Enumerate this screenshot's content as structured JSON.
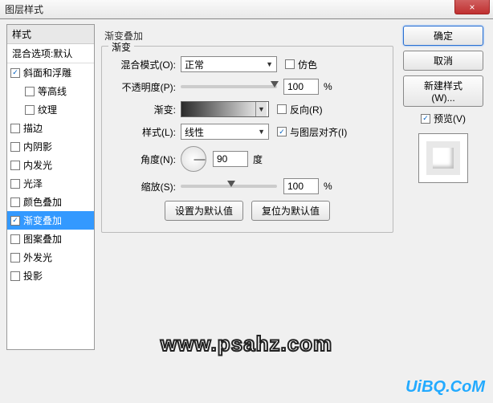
{
  "window": {
    "title": "图层样式",
    "close": "×"
  },
  "sidebar": {
    "header": "样式",
    "blend": "混合选项:默认",
    "items": [
      {
        "label": "斜面和浮雕",
        "checked": true,
        "indent": false
      },
      {
        "label": "等高线",
        "checked": false,
        "indent": true
      },
      {
        "label": "纹理",
        "checked": false,
        "indent": true
      },
      {
        "label": "描边",
        "checked": false,
        "indent": false
      },
      {
        "label": "内阴影",
        "checked": false,
        "indent": false
      },
      {
        "label": "内发光",
        "checked": false,
        "indent": false
      },
      {
        "label": "光泽",
        "checked": false,
        "indent": false
      },
      {
        "label": "颜色叠加",
        "checked": false,
        "indent": false
      },
      {
        "label": "渐变叠加",
        "checked": true,
        "indent": false,
        "selected": true
      },
      {
        "label": "图案叠加",
        "checked": false,
        "indent": false
      },
      {
        "label": "外发光",
        "checked": false,
        "indent": false
      },
      {
        "label": "投影",
        "checked": false,
        "indent": false
      }
    ]
  },
  "panel": {
    "title": "渐变叠加",
    "legend": "渐变",
    "blendMode": {
      "label": "混合模式(O):",
      "value": "正常",
      "dither": "仿色"
    },
    "opacity": {
      "label": "不透明度(P):",
      "value": "100",
      "unit": "%"
    },
    "gradient": {
      "label": "渐变:",
      "reverse": "反向(R)"
    },
    "style": {
      "label": "样式(L):",
      "value": "线性",
      "align": "与图层对齐(I)"
    },
    "angle": {
      "label": "角度(N):",
      "value": "90",
      "unit": "度"
    },
    "scale": {
      "label": "缩放(S):",
      "value": "100",
      "unit": "%"
    },
    "defaults": {
      "set": "设置为默认值",
      "reset": "复位为默认值"
    }
  },
  "right": {
    "ok": "确定",
    "cancel": "取消",
    "newStyle": "新建样式(W)...",
    "preview": "预览(V)"
  },
  "watermarks": {
    "url1": "www.psahz.com",
    "url2": "UiBQ.CoM"
  }
}
